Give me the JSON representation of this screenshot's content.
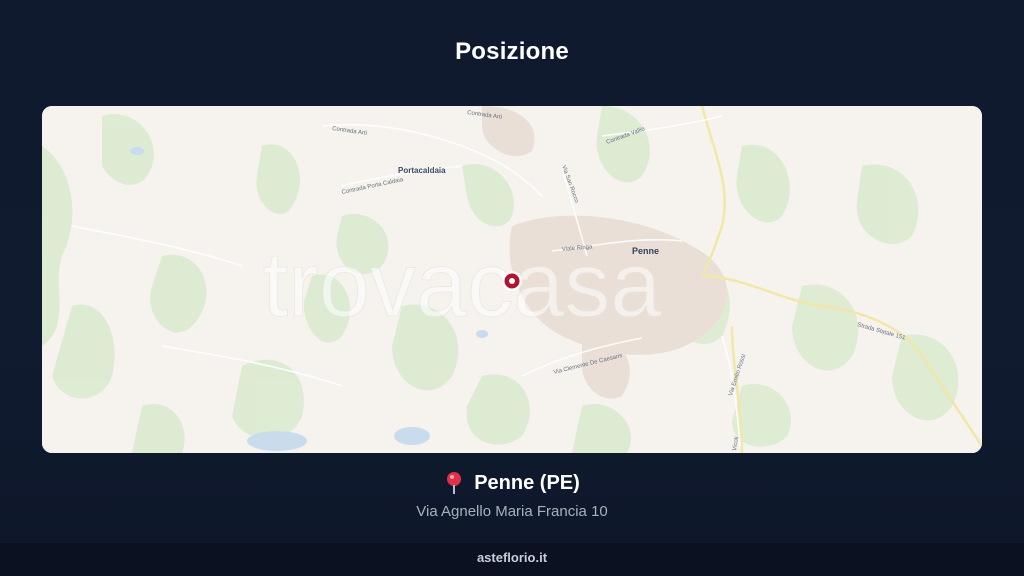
{
  "title": "Posizione",
  "map": {
    "watermark": "trovacasa",
    "labels": {
      "portacaldaia": "Portacaldaia",
      "penne": "Penne",
      "contrada_arti_1": "Contrada Arti",
      "contrada_arti_2": "Contrada Arti",
      "contrada_porta_caldaia": "Contrada Porta Caldaia",
      "contrada_valloni": "Contrada Vallio",
      "via_san_rocco": "Via San Rocco",
      "viale_ringa": "Viale Ringa",
      "via_clemente": "Via Clemente De Caesaris",
      "via_emilio_rossi": "Via Emilio Rossi",
      "strada_statale": "Strada Statale 151",
      "via_bottom": "Vicoli"
    }
  },
  "location": {
    "city": "Penne (PE)",
    "address": "Via Agnello Maria Francia 10"
  },
  "footer": "asteflorio.it"
}
